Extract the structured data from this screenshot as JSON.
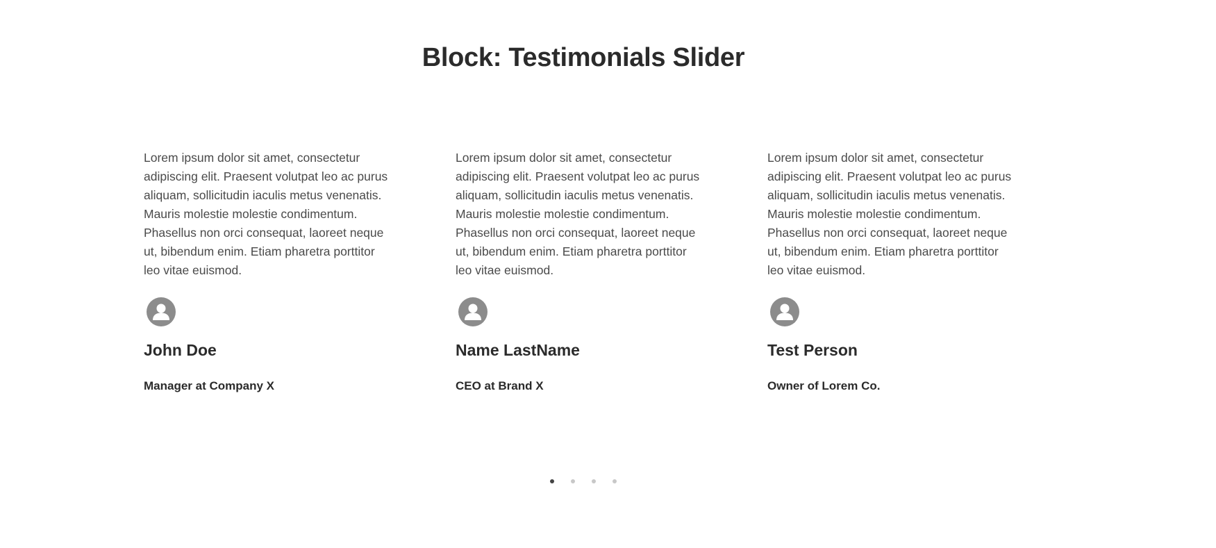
{
  "header": {
    "title": "Block: Testimonials Slider"
  },
  "testimonials": [
    {
      "quote": "Lorem ipsum dolor sit amet, consectetur adipiscing elit. Praesent volutpat leo ac purus aliquam, sollicitudin iaculis metus venenatis. Mauris molestie molestie condimentum. Phasellus non orci consequat, laoreet neque ut, bibendum enim. Etiam pharetra porttitor leo vitae euismod.",
      "avatar_icon": "user-avatar-icon",
      "name": "John Doe",
      "role": "Manager at Company X"
    },
    {
      "quote": "Lorem ipsum dolor sit amet, consectetur adipiscing elit. Praesent volutpat leo ac purus aliquam, sollicitudin iaculis metus venenatis. Mauris molestie molestie condimentum. Phasellus non orci consequat, laoreet neque ut, bibendum enim. Etiam pharetra porttitor leo vitae euismod.",
      "avatar_icon": "user-avatar-icon",
      "name": "Name LastName",
      "role": "CEO at Brand X"
    },
    {
      "quote": "Lorem ipsum dolor sit amet, consectetur adipiscing elit. Praesent volutpat leo ac purus aliquam, sollicitudin iaculis metus venenatis. Mauris molestie molestie condimentum. Phasellus non orci consequat, laoreet neque ut, bibendum enim. Etiam pharetra porttitor leo vitae euismod.",
      "avatar_icon": "user-avatar-icon",
      "name": "Test Person",
      "role": "Owner of Lorem Co."
    }
  ],
  "pagination": {
    "total": 4,
    "active_index": 0
  },
  "colors": {
    "text_heading": "#2b2b2b",
    "text_body": "#4a4a4a",
    "avatar": "#8c8c8c",
    "dot_active": "#444444",
    "dot_inactive": "#c8c8c8"
  }
}
